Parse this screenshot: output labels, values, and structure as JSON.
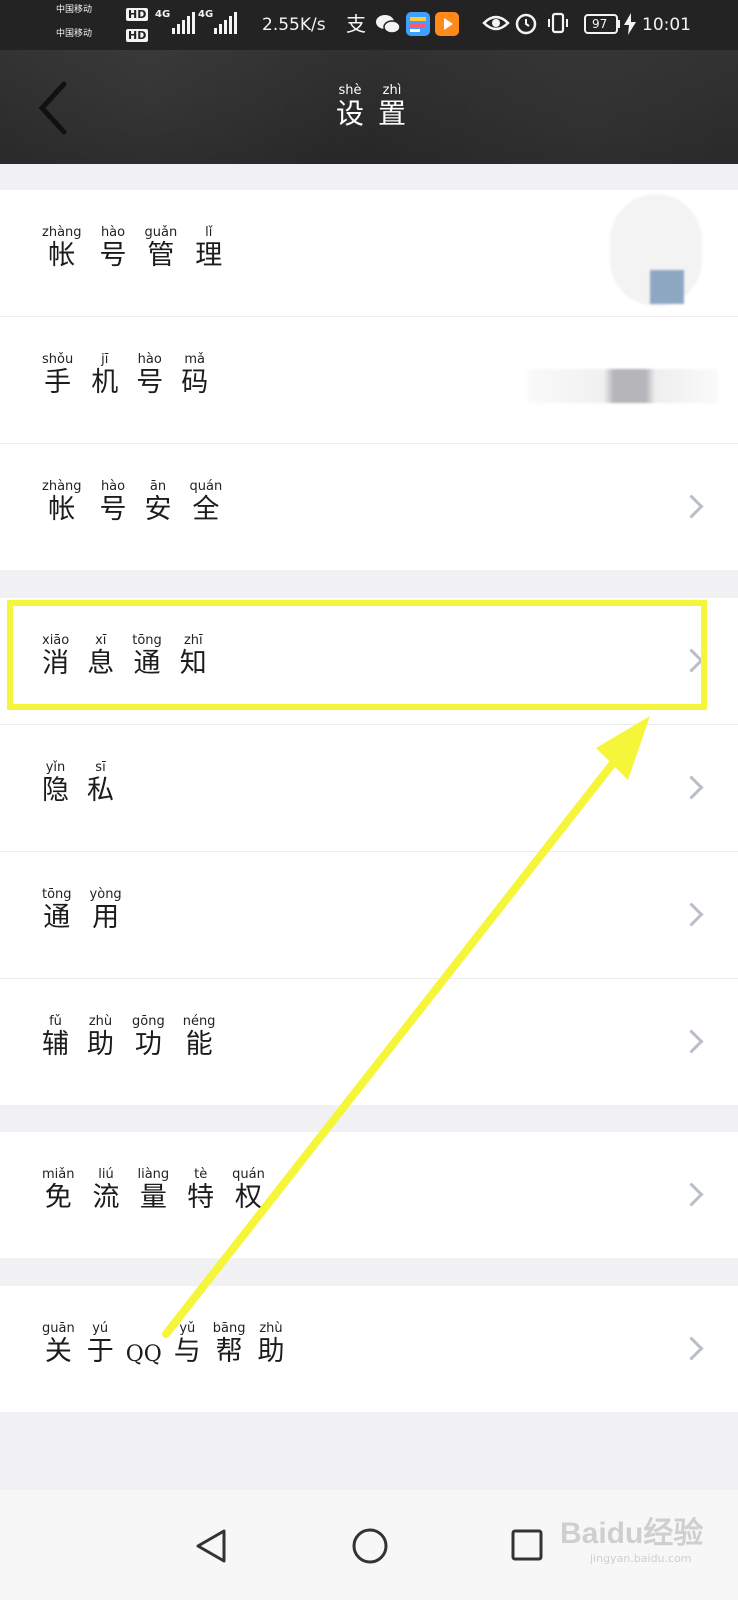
{
  "status_bar": {
    "carrier_top": "中国移动",
    "carrier_bottom": "中国移动",
    "hd": "HD",
    "network_1": "4G",
    "network_2": "4G",
    "speed": "2.55K/s",
    "battery": "97",
    "time": "10:01"
  },
  "title_bar": {
    "title_pinyin": [
      "shè",
      "zhì"
    ],
    "title_chars": [
      "设",
      "置"
    ]
  },
  "sections": [
    {
      "items": [
        {
          "pinyin": [
            "zhàng",
            "hào",
            "guǎn",
            "lǐ"
          ],
          "chars": [
            "帐",
            "号",
            "管",
            "理"
          ]
        },
        {
          "pinyin": [
            "shǒu",
            "jī",
            "hào",
            "mǎ"
          ],
          "chars": [
            "手",
            "机",
            "号",
            "码"
          ]
        },
        {
          "pinyin": [
            "zhàng",
            "hào",
            "ān",
            "quán"
          ],
          "chars": [
            "帐",
            "号",
            "安",
            "全"
          ]
        }
      ]
    },
    {
      "items": [
        {
          "pinyin": [
            "xiāo",
            "xī",
            "tōng",
            "zhī"
          ],
          "chars": [
            "消",
            "息",
            "通",
            "知"
          ]
        },
        {
          "pinyin": [
            "yǐn",
            "sī"
          ],
          "chars": [
            "隐",
            "私"
          ]
        },
        {
          "pinyin": [
            "tōng",
            "yòng"
          ],
          "chars": [
            "通",
            "用"
          ]
        },
        {
          "pinyin": [
            "fǔ",
            "zhù",
            "gōng",
            "néng"
          ],
          "chars": [
            "辅",
            "助",
            "功",
            "能"
          ]
        }
      ]
    },
    {
      "items": [
        {
          "pinyin": [
            "miǎn",
            "liú",
            "liàng",
            "tè",
            "quán"
          ],
          "chars": [
            "免",
            "流",
            "量",
            "特",
            "权"
          ]
        }
      ]
    },
    {
      "items": [
        {
          "pinyin": [
            "guān",
            "yú",
            "",
            "yǔ",
            "bāng",
            "zhù"
          ],
          "chars": [
            "关",
            "于",
            "QQ",
            "与",
            "帮",
            "助"
          ]
        }
      ]
    }
  ],
  "watermark": {
    "text": "Baidu经验",
    "sub": "jingyan.baidu.com"
  },
  "colors": {
    "highlight": "#f5f53a",
    "title_bg": "#2a2a2a",
    "chevron": "#b9bec8"
  }
}
